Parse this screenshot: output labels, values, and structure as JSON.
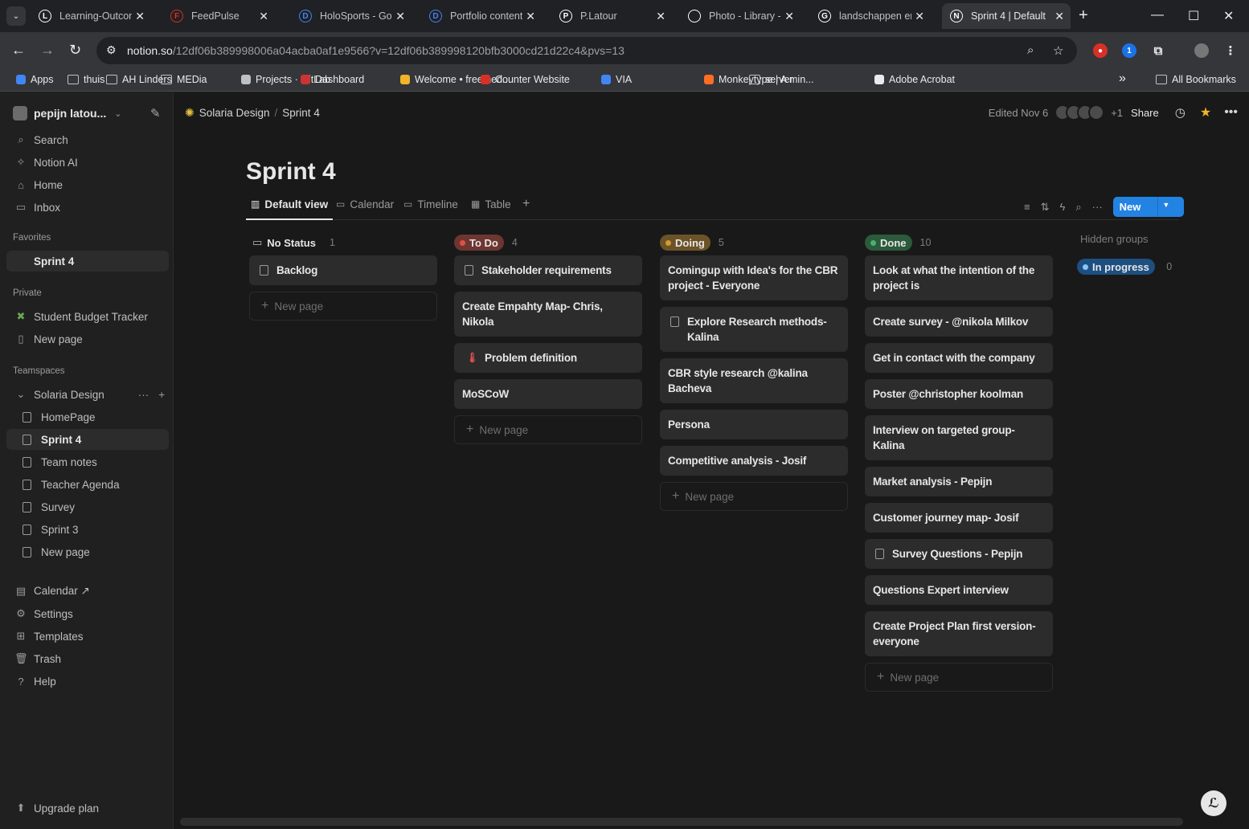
{
  "browser": {
    "tabs": [
      {
        "title": "Learning-Outcom",
        "icon": "L",
        "color": "#ffffff"
      },
      {
        "title": "FeedPulse",
        "icon": "F",
        "color": "#d93025"
      },
      {
        "title": "HoloSports - Goo",
        "icon": "D",
        "color": "#4285f4"
      },
      {
        "title": "Portfolio content",
        "icon": "D",
        "color": "#4285f4"
      },
      {
        "title": "P.Latour",
        "icon": "P",
        "color": "#ffffff"
      },
      {
        "title": "Photo - Library -",
        "icon": "",
        "color": "#ffffff"
      },
      {
        "title": "landschappen en",
        "icon": "G",
        "color": "#ffffff"
      },
      {
        "title": "Sprint 4 | Default",
        "icon": "N",
        "color": "#ffffff"
      }
    ],
    "url_host": "notion.so",
    "url_path": "/12df06b389998006a04acba0af1e9566?v=12df06b389998120bfb3000cd21d22c4&pvs=13",
    "bookmarks": [
      "Apps",
      "thuis",
      "AH Linders",
      "MEDia",
      "Projects · GitLab",
      "Dashboard",
      "Welcome • freemed...",
      "Counter Website",
      "VIA",
      "Monkeytype | A min...",
      "server",
      "Adobe Acrobat",
      "All Bookmarks"
    ]
  },
  "sidebar": {
    "workspace": "pepijn latou...",
    "top_items": [
      "Search",
      "Notion AI",
      "Home",
      "Inbox"
    ],
    "favorites_label": "Favorites",
    "favorite": "Sprint 4",
    "private_label": "Private",
    "private_items": [
      "Student Budget Tracker",
      "New page"
    ],
    "teamspaces_label": "Teamspaces",
    "teamspace": "Solaria Design",
    "team_pages": [
      "HomePage",
      "Sprint 4",
      "Team notes",
      "Teacher Agenda",
      "Survey",
      "Sprint 3",
      "New page"
    ],
    "bottom_items": [
      "Calendar ↗",
      "Settings",
      "Templates",
      "Trash",
      "Help"
    ],
    "upgrade": "Upgrade plan"
  },
  "topbar": {
    "crumb_workspace": "Solaria Design",
    "crumb_page": "Sprint 4",
    "edited": "Edited Nov 6",
    "more_count": "+1",
    "share": "Share"
  },
  "page": {
    "title": "Sprint 4",
    "views": [
      "Default view",
      "Calendar",
      "Timeline",
      "Table"
    ],
    "new_button": "New",
    "new_page_label": "New page",
    "hidden_groups_label": "Hidden groups",
    "hidden_group": {
      "name": "In progress",
      "count": "0",
      "color": "#2383e2"
    },
    "columns": [
      {
        "name": "No Status",
        "count": "1",
        "color": "",
        "cards": [
          {
            "text": "Backlog",
            "icon": true
          }
        ]
      },
      {
        "name": "To Do",
        "count": "4",
        "color": "#6e3630",
        "dot": "#e0504a",
        "cards": [
          {
            "text": "Stakeholder requirements",
            "icon": true
          },
          {
            "text": "Create Empahty Map- Chris, Nikola",
            "icon": false
          },
          {
            "text": "Problem definition",
            "icon": "thermo"
          },
          {
            "text": "MoSCoW",
            "icon": false
          }
        ]
      },
      {
        "name": "Doing",
        "count": "5",
        "color": "#6b5327",
        "dot": "#d39a2e",
        "cards": [
          {
            "text": "Comingup with Idea's for the CBR project - Everyone",
            "icon": false
          },
          {
            "text": "Explore Research methods- Kalina",
            "icon": true
          },
          {
            "text": "CBR style research @kalina Bacheva",
            "icon": false
          },
          {
            "text": "Persona",
            "icon": false
          },
          {
            "text": "Competitive analysis - Josif",
            "icon": false
          }
        ]
      },
      {
        "name": "Done",
        "count": "10",
        "color": "#2b5a3c",
        "dot": "#4caf6e",
        "cards": [
          {
            "text": "Look at what the intention of the project is",
            "icon": false
          },
          {
            "text": "Create survey - @nikola Milkov",
            "icon": false
          },
          {
            "text": "Get in contact with the company",
            "icon": false
          },
          {
            "text": "Poster @christopher koolman",
            "icon": false
          },
          {
            "text": "Interview on targeted group- Kalina",
            "icon": false
          },
          {
            "text": "Market analysis - Pepijn",
            "icon": false
          },
          {
            "text": "Customer journey map- Josif",
            "icon": false
          },
          {
            "text": "Survey Questions - Pepijn",
            "icon": true
          },
          {
            "text": "Questions Expert interview",
            "icon": false
          },
          {
            "text": "Create Project Plan first version- everyone",
            "icon": false
          }
        ]
      }
    ]
  }
}
